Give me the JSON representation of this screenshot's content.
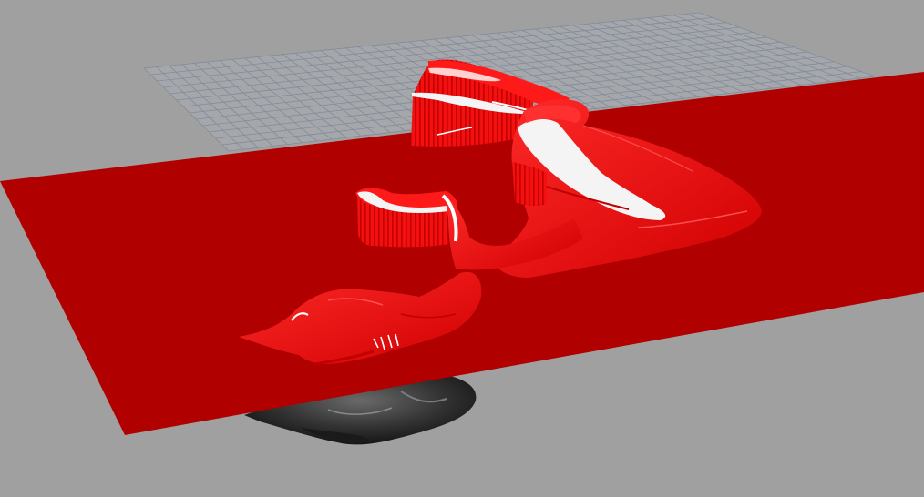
{
  "viewport": {
    "background_color": "#a0a0a0"
  },
  "scene": {
    "grid": {
      "line_color": "#7f8c9c",
      "fill_color": "#a4a4a8"
    },
    "section_plane": {
      "color": "#b10000"
    },
    "model": {
      "cut_color": "#ee0000",
      "highlight_color": "#ffffff",
      "shadow_color": "#a80000",
      "below_plane_color": "#3c3c3c"
    }
  }
}
